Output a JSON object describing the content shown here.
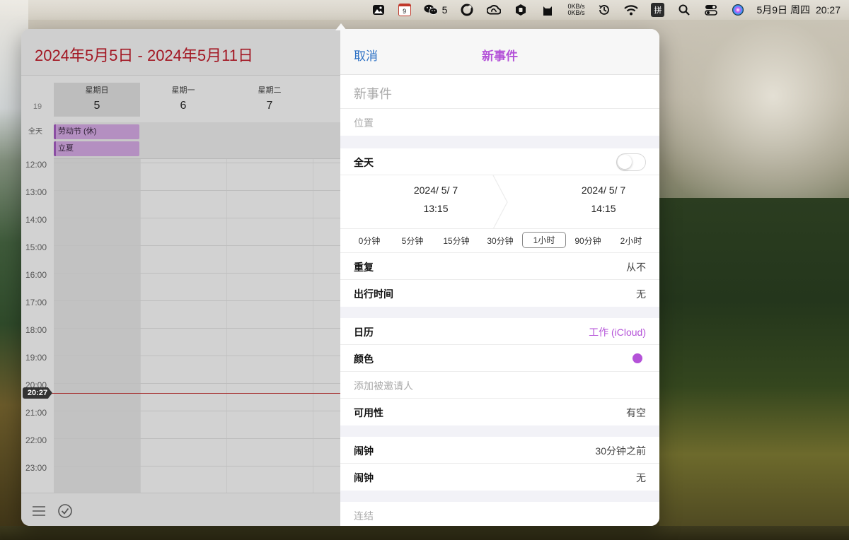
{
  "menubar": {
    "wechat_count": "5",
    "calendar_icon_day": "9",
    "net_up": "0KB/s",
    "net_down": "0KB/s",
    "input_method": "拼",
    "date": "5月9日 周四",
    "time": "20:27"
  },
  "calendar": {
    "title": "2024年5月5日 - 2024年5月11日",
    "week_number": "19",
    "days": [
      {
        "name": "星期日",
        "num": "5"
      },
      {
        "name": "星期一",
        "num": "6"
      },
      {
        "name": "星期二",
        "num": "7"
      }
    ],
    "allday_label": "全天",
    "allday_events": [
      "劳动节 (休)",
      "立夏"
    ],
    "hours": [
      "12:00",
      "13:00",
      "14:00",
      "15:00",
      "16:00",
      "17:00",
      "18:00",
      "19:00",
      "20:00",
      "21:00",
      "22:00",
      "23:00"
    ],
    "now": "20:27"
  },
  "event": {
    "cancel": "取消",
    "title": "新事件",
    "title_placeholder": "新事件",
    "location_placeholder": "位置",
    "allday_label": "全天",
    "start_date": "2024/  5/  7",
    "start_time": "13:15",
    "end_date": "2024/  5/  7",
    "end_time": "14:15",
    "durations": [
      "0分钟",
      "5分钟",
      "15分钟",
      "30分钟",
      "1小时",
      "90分钟",
      "2小时"
    ],
    "selected_duration": "1小时",
    "repeat_label": "重复",
    "repeat_value": "从不",
    "travel_label": "出行时间",
    "travel_value": "无",
    "calendar_label": "日历",
    "calendar_value": "工作 (iCloud)",
    "color_label": "颜色",
    "invitees_placeholder": "添加被邀请人",
    "availability_label": "可用性",
    "availability_value": "有空",
    "alarm1_label": "闹钟",
    "alarm1_value": "30分钟之前",
    "alarm2_label": "闹钟",
    "alarm2_value": "无",
    "url_placeholder": "连结",
    "accent_color": "#b452d8"
  }
}
